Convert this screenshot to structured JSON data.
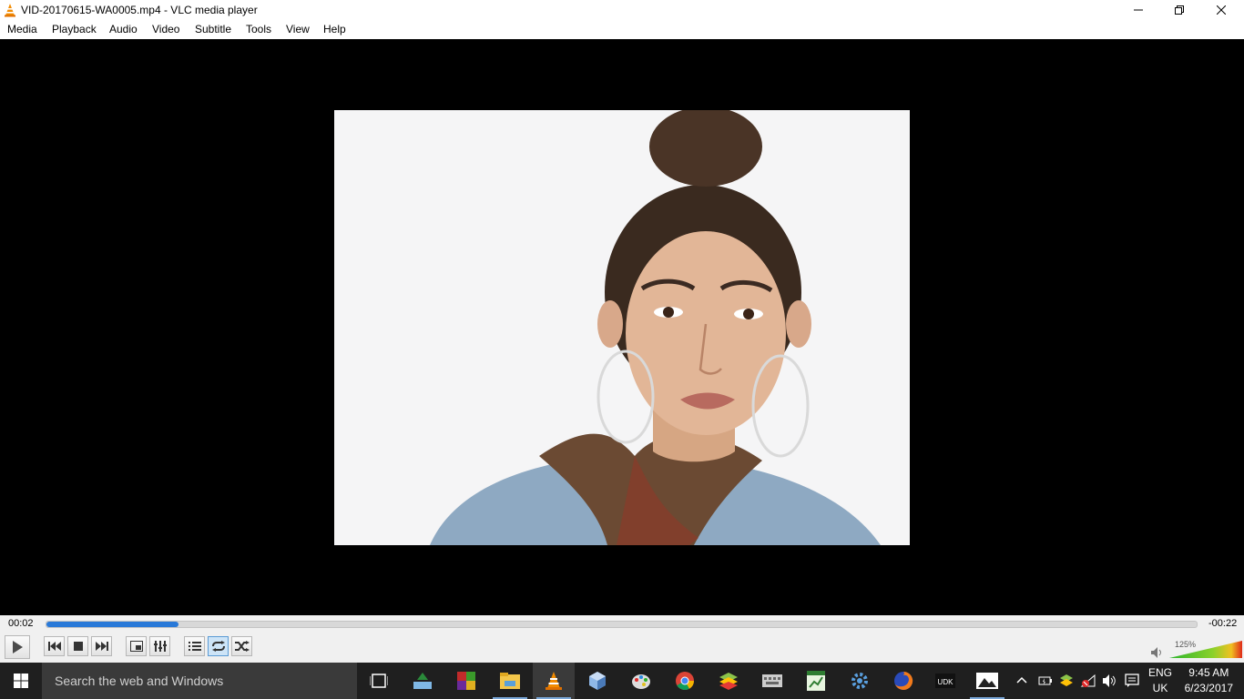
{
  "window": {
    "title": "VID-20170615-WA0005.mp4 - VLC media player",
    "minimize_icon": "minimize-icon",
    "restore_icon": "restore-icon",
    "close_icon": "close-icon"
  },
  "menu": {
    "items": [
      "Media",
      "Playback",
      "Audio",
      "Video",
      "Subtitle",
      "Tools",
      "View",
      "Help"
    ]
  },
  "player": {
    "elapsed": "00:02",
    "remaining": "-00:22",
    "progress_fraction": 0.115,
    "volume_label": "125%",
    "accent_color": "#2979d8"
  },
  "taskbar": {
    "search_placeholder": "Search the web and Windows",
    "language_line1": "ENG",
    "language_line2": "UK",
    "time": "9:45 AM",
    "date": "6/23/2017"
  }
}
